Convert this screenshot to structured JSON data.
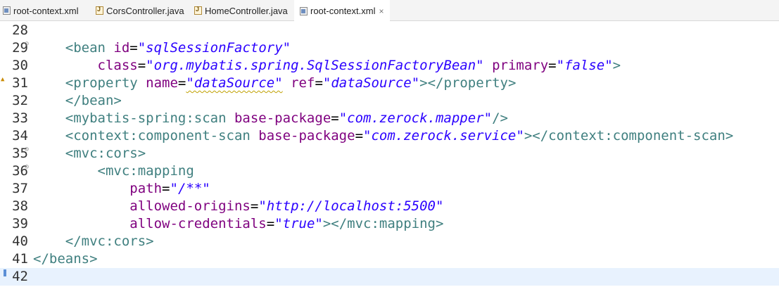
{
  "tabs": [
    {
      "label": "root-context.xml",
      "icon": "xml-file-icon",
      "active": false
    },
    {
      "label": "CorsController.java",
      "icon": "java-file-icon",
      "active": false
    },
    {
      "label": "HomeController.java",
      "icon": "java-file-icon",
      "active": false
    },
    {
      "label": "root-context.xml",
      "icon": "xml-file-icon",
      "active": true,
      "close": "×"
    }
  ],
  "lines": [
    {
      "num": "28",
      "tokens": []
    },
    {
      "num": "29",
      "fold": true,
      "tokens": [
        {
          "t": "    <bean ",
          "c": "tag"
        },
        {
          "t": "id",
          "c": "attr"
        },
        {
          "t": "=",
          "c": "plain"
        },
        {
          "t": "\"sqlSessionFactory\"",
          "c": "val"
        }
      ]
    },
    {
      "num": "30",
      "tokens": [
        {
          "t": "        ",
          "c": "plain"
        },
        {
          "t": "class",
          "c": "attr"
        },
        {
          "t": "=",
          "c": "plain"
        },
        {
          "t": "\"org.mybatis.spring.SqlSessionFactoryBean\"",
          "c": "val"
        },
        {
          "t": " ",
          "c": "plain"
        },
        {
          "t": "primary",
          "c": "attr"
        },
        {
          "t": "=",
          "c": "plain"
        },
        {
          "t": "\"false\"",
          "c": "val"
        },
        {
          "t": ">",
          "c": "tag"
        }
      ]
    },
    {
      "num": "31",
      "warn": true,
      "tokens": [
        {
          "t": "    <property ",
          "c": "tag"
        },
        {
          "t": "name",
          "c": "attr"
        },
        {
          "t": "=",
          "c": "plain"
        },
        {
          "t": "\"dataSource\"",
          "c": "val squiggle"
        },
        {
          "t": " ",
          "c": "plain"
        },
        {
          "t": "ref",
          "c": "attr"
        },
        {
          "t": "=",
          "c": "plain"
        },
        {
          "t": "\"dataSource\"",
          "c": "val"
        },
        {
          "t": "></property>",
          "c": "tag"
        }
      ]
    },
    {
      "num": "32",
      "tokens": [
        {
          "t": "    </bean>",
          "c": "tag"
        }
      ]
    },
    {
      "num": "33",
      "tokens": [
        {
          "t": "    <mybatis-spring:scan ",
          "c": "tag"
        },
        {
          "t": "base-package",
          "c": "attr"
        },
        {
          "t": "=",
          "c": "plain"
        },
        {
          "t": "\"com.zerock.mapper\"",
          "c": "val"
        },
        {
          "t": "/>",
          "c": "tag"
        }
      ]
    },
    {
      "num": "34",
      "tokens": [
        {
          "t": "    <context:component-scan ",
          "c": "tag"
        },
        {
          "t": "base-package",
          "c": "attr"
        },
        {
          "t": "=",
          "c": "plain"
        },
        {
          "t": "\"com.zerock.service\"",
          "c": "val"
        },
        {
          "t": "></context:component-scan>",
          "c": "tag"
        }
      ]
    },
    {
      "num": "35",
      "fold": true,
      "tokens": [
        {
          "t": "    <mvc:cors>",
          "c": "tag"
        }
      ]
    },
    {
      "num": "36",
      "fold": true,
      "tokens": [
        {
          "t": "        <mvc:mapping",
          "c": "tag"
        }
      ]
    },
    {
      "num": "37",
      "tokens": [
        {
          "t": "            ",
          "c": "plain"
        },
        {
          "t": "path",
          "c": "attr"
        },
        {
          "t": "=",
          "c": "plain"
        },
        {
          "t": "\"/**\"",
          "c": "val"
        }
      ]
    },
    {
      "num": "38",
      "tokens": [
        {
          "t": "            ",
          "c": "plain"
        },
        {
          "t": "allowed-origins",
          "c": "attr"
        },
        {
          "t": "=",
          "c": "plain"
        },
        {
          "t": "\"http://localhost:5500\"",
          "c": "val"
        }
      ]
    },
    {
      "num": "39",
      "tokens": [
        {
          "t": "            ",
          "c": "plain"
        },
        {
          "t": "allow-credentials",
          "c": "attr"
        },
        {
          "t": "=",
          "c": "plain"
        },
        {
          "t": "\"true\"",
          "c": "val"
        },
        {
          "t": "></mvc:mapping>",
          "c": "tag"
        }
      ]
    },
    {
      "num": "40",
      "tokens": [
        {
          "t": "    </mvc:cors>",
          "c": "tag"
        }
      ]
    },
    {
      "num": "41",
      "tokens": [
        {
          "t": "</beans>",
          "c": "tag"
        }
      ]
    },
    {
      "num": "42",
      "current": true,
      "tokens": []
    }
  ],
  "colors": {
    "tag": "#3f7f7f",
    "attribute": "#7f007f",
    "value": "#2a00ff",
    "current_line": "#e8f2fe"
  }
}
